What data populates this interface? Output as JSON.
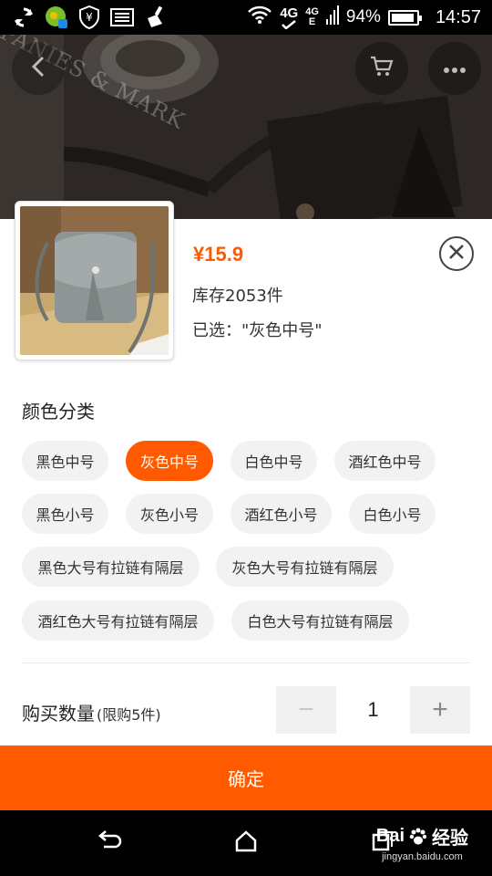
{
  "status_bar": {
    "battery": "94%",
    "battery_level": 0.94,
    "time": "14:57",
    "network_top": "4G",
    "network_bottom": "E",
    "signal_label": "4G"
  },
  "hero": {
    "back_icon": "chevron-left-icon",
    "cart_icon": "shopping-cart-icon",
    "more_icon": "more-dots-icon",
    "photo_text": "PANIES & MARK"
  },
  "product": {
    "price": "¥15.9",
    "stock": "库存2053件",
    "selected": "已选：\"灰色中号\"",
    "close_icon": "close-circle-icon"
  },
  "color_section": {
    "title": "颜色分类",
    "options": [
      {
        "label": "黑色中号",
        "active": false
      },
      {
        "label": "灰色中号",
        "active": true
      },
      {
        "label": "白色中号",
        "active": false
      },
      {
        "label": "酒红色中号",
        "active": false
      },
      {
        "label": "黑色小号",
        "active": false
      },
      {
        "label": "灰色小号",
        "active": false
      },
      {
        "label": "酒红色小号",
        "active": false
      },
      {
        "label": "白色小号",
        "active": false
      },
      {
        "label": "黑色大号有拉链有隔层",
        "active": false
      },
      {
        "label": "灰色大号有拉链有隔层",
        "active": false
      },
      {
        "label": "酒红色大号有拉链有隔层",
        "active": false
      },
      {
        "label": "白色大号有拉链有隔层",
        "active": false
      }
    ]
  },
  "quantity": {
    "label": "购买数量",
    "limit": "(限购5件)",
    "minus": "−",
    "value": "1",
    "plus": "+"
  },
  "confirm_label": "确定",
  "watermark": {
    "brand": "经验",
    "url": "jingyan.baidu.com",
    "prefix": "Bai"
  },
  "colors": {
    "accent": "#ff5a00",
    "chip_bg": "#f2f2f2"
  }
}
